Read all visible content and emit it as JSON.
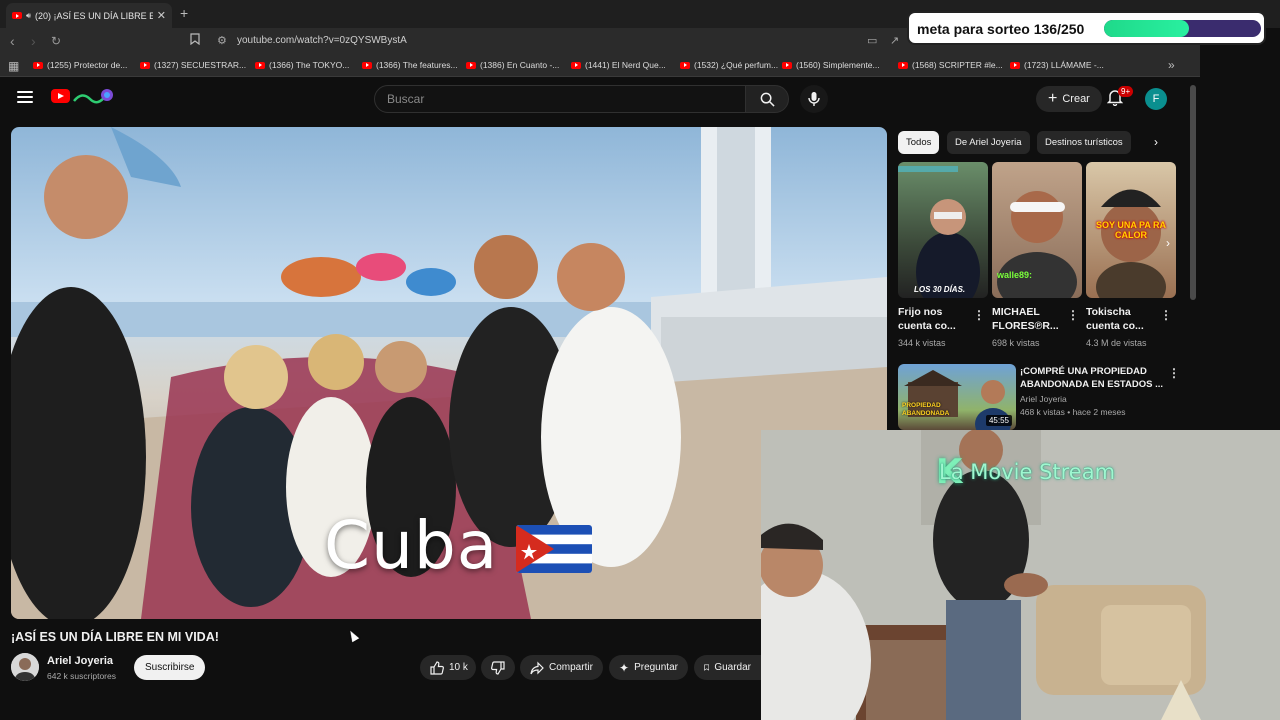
{
  "browser": {
    "tab_title": "(20) ¡ASÍ ES UN DÍA LIBRE EN",
    "url": "youtube.com/watch?v=0zQYSWBystA",
    "bookmarks": [
      "(1255) Protector de...",
      "(1327) SECUESTRAR...",
      "(1366) The TOKYO...",
      "(1366) The features...",
      "(1386) En Cuanto -...",
      "(1441) El Nerd Que...",
      "(1532) ¿Qué perfum...",
      "(1560) Simplemente...",
      "(1568) SCRIPTER #le...",
      "(1723) LLÁMAME -..."
    ]
  },
  "header": {
    "search_placeholder": "Buscar",
    "create_label": "Crear",
    "notif_count": "9+",
    "avatar_letter": "F"
  },
  "video": {
    "overlay_text": "Cuba",
    "title": "¡ASÍ ES UN DÍA LIBRE EN MI VIDA!",
    "channel": "Ariel Joyeria",
    "subscribers": "642 k suscriptores",
    "subscribe_label": "Suscribirse",
    "likes": "10 k",
    "share_label": "Compartir",
    "ask_label": "Preguntar",
    "save_label": "Guardar"
  },
  "chips": [
    "Todos",
    "De Ariel Joyeria",
    "Destinos turísticos"
  ],
  "shorts": [
    {
      "title_1": "Frijo nos",
      "title_2": "cuenta co...",
      "views": "344 k vistas",
      "overlay": "LOS 30 DÍAS."
    },
    {
      "title_1": "MICHAEL",
      "title_2": "FLORES℗R...",
      "views": "698 k vistas",
      "overlay": "walle89:"
    },
    {
      "title_1": "Tokischa",
      "title_2": "cuenta co...",
      "views": "4.3 M de vistas",
      "overlay": "SOY UNA PA RA CALOR"
    }
  ],
  "recommended": {
    "title": "¡COMPRÉ UNA PROPIEDAD ABANDONADA EN ESTADOS ...",
    "channel": "Ariel Joyeria",
    "meta": "468 k vistas • hace 2 meses",
    "duration": "45:55",
    "thumb_text": "PROPIEDAD ABANDONADA"
  },
  "stream": {
    "cam_title_k": "K",
    "cam_title": "La Movie Stream",
    "goal_text": "meta para sorteo 136/250",
    "goal_current": 136,
    "goal_total": 250
  },
  "colors": {
    "bg": "#0f0f0f",
    "youtube_red": "#ff0000",
    "goal_fill": "#1fd98a",
    "goal_track": "#3a2c6e",
    "cam_title": "#9ff7d0"
  }
}
